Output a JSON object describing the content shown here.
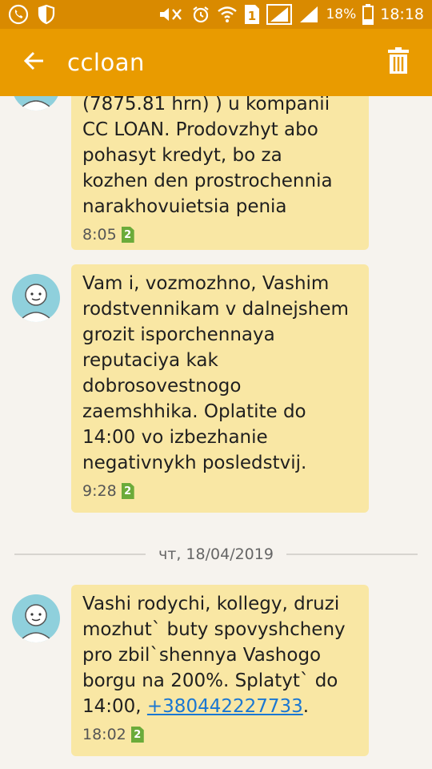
{
  "status_bar": {
    "battery_percent": "18%",
    "time": "18:18",
    "sim_number": "1"
  },
  "app_bar": {
    "title": "ccloan"
  },
  "messages": [
    {
      "text": "(7875.81 hrn) ) u kompanii\nCC LOAN. Prodovzhyt abo\npohasyt kredyt, bo za\nkozhen den prostrochennia\nnarakhovuietsia penia",
      "time": "8:05",
      "sim": "2"
    },
    {
      "text": "Vam i, vozmozhno, Vashim\nrodstvennikam v dalnejshem\ngrozit isporchennaya\nreputaciya kak\ndobrosovestnogo\nzaemshhika. Oplatite do\n14:00 vo izbezhanie\nnegativnykh posledstvij.",
      "time": "9:28",
      "sim": "2"
    },
    {
      "text": "Vashi rodychi, kollegy, druzi\nmozhut` buty spovyshcheny\npro zbil`shennya Vashogo\nborgu na 200%. Splatyt` do\n14:00, ",
      "link": "+380442227733",
      "text_after": ".",
      "time": "18:02",
      "sim": "2"
    }
  ],
  "date_separator": "чт, 18/04/2019"
}
